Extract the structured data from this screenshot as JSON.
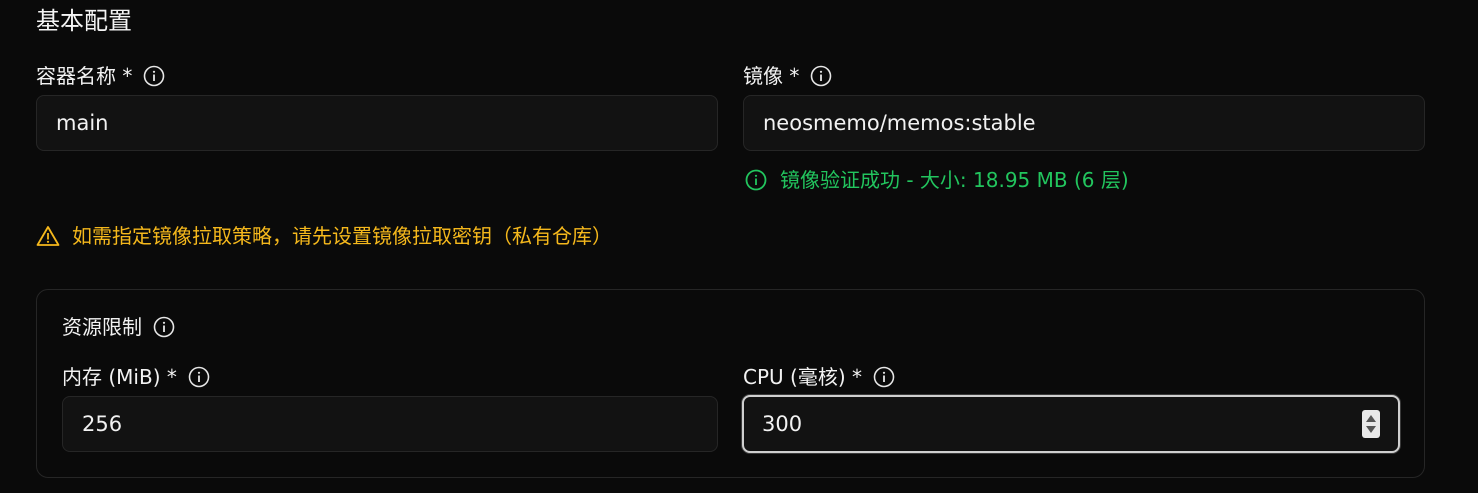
{
  "section": {
    "title": "基本配置"
  },
  "container_name": {
    "label": "容器名称 *",
    "value": "main"
  },
  "image": {
    "label": "镜像 *",
    "value": "neosmemo/memos:stable"
  },
  "image_status": "镜像验证成功 - 大小: 18.95 MB (6 层)",
  "pull_warning": "如需指定镜像拉取策略，请先设置镜像拉取密钥（私有仓库）",
  "resources": {
    "title": "资源限制",
    "memory": {
      "label": "内存 (MiB) *",
      "value": "256"
    },
    "cpu": {
      "label": "CPU (毫核) *",
      "value": "300"
    }
  },
  "colors": {
    "success": "#22c55e",
    "warning": "#f5b81c",
    "background": "#0a0a0a",
    "input_bg": "#121212"
  },
  "icons": {
    "info": "info-circle-icon",
    "warning": "warning-triangle-icon"
  }
}
